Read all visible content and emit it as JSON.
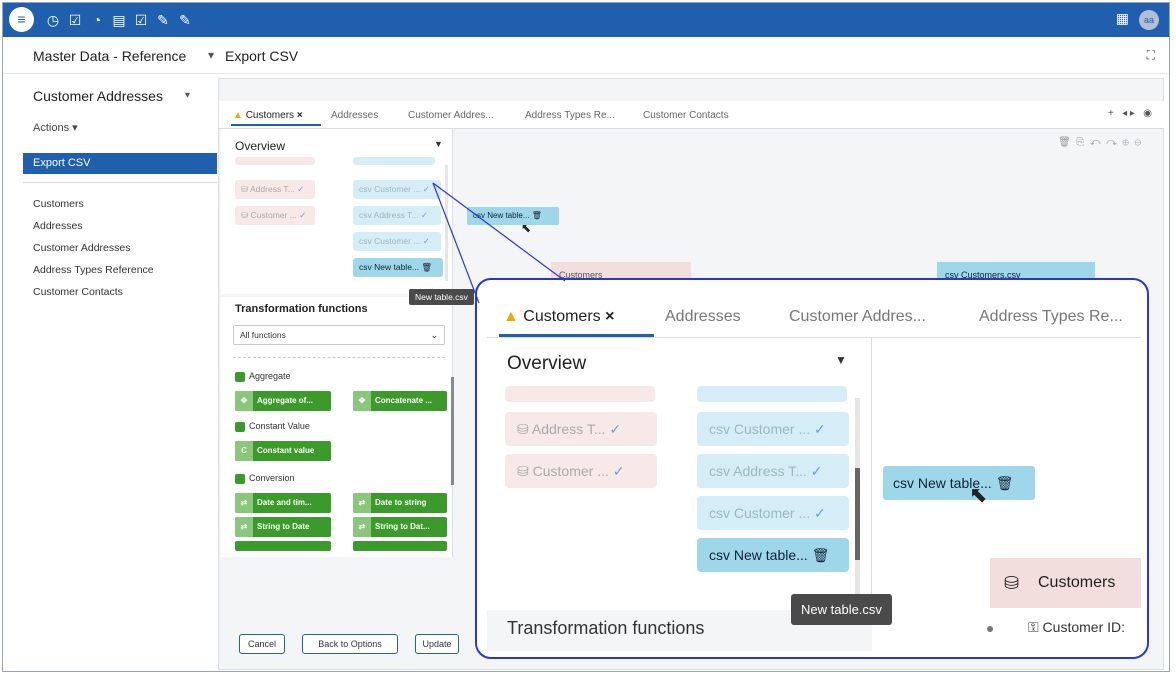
{
  "app": {
    "logo_label": "≡",
    "toolbar_icons": [
      "clock-icon",
      "check-icon",
      "gauge-icon",
      "document-icon",
      "task-icon",
      "plug-icon",
      "wrench-icon"
    ],
    "avatar": "aa"
  },
  "header": {
    "project": "Master Data - Reference",
    "page": "Export CSV"
  },
  "sidebar": {
    "title": "Customer Addresses",
    "actions": "Actions ▾",
    "active": "Export CSV",
    "items": [
      "Customers",
      "Addresses",
      "Customer Addresses",
      "Address Types Reference",
      "Customer Contacts"
    ]
  },
  "tabs": {
    "active": "Customers",
    "items": [
      "Addresses",
      "Customer Addres...",
      "Address Types Re...",
      "Customer Contacts"
    ]
  },
  "overview": {
    "title": "Overview",
    "db_items": [
      "Address T...",
      "Customer ..."
    ],
    "csv_items": [
      "Customer ...",
      "Address T...",
      "Customer ..."
    ],
    "new_table": "New table...",
    "tooltip": "New table.csv"
  },
  "transform": {
    "title": "Transformation functions",
    "filter": "All functions",
    "cat_aggregate": "Aggregate",
    "aggregate_fns": [
      "Aggregate of...",
      "Concatenate ..."
    ],
    "cat_constant": "Constant Value",
    "constant_fn": "Constant value",
    "cat_conversion": "Conversion",
    "conversion_fns": [
      "Date and tim...",
      "Date to string",
      "String to Date",
      "String to Dat..."
    ]
  },
  "canvas": {
    "new_table": "New table...",
    "bg_customers": "Customers",
    "bg_customers_csv": "Customers.csv"
  },
  "buttons": {
    "cancel": "Cancel",
    "back": "Back to Options",
    "update": "Update"
  },
  "zoom": {
    "tab_active": "Customers",
    "tabs": [
      "Addresses",
      "Customer Addres...",
      "Address Types Re..."
    ],
    "ov_title": "Overview",
    "db_items": [
      "Address T...",
      "Customer ..."
    ],
    "csv_items": [
      "Customer ...",
      "Address T...",
      "Customer ..."
    ],
    "new_table": "New table...",
    "tooltip": "New table.csv",
    "tf_title": "Transformation functions",
    "canvas_new": "New table...",
    "customers_node": "Customers",
    "customer_id": "Customer ID:"
  },
  "colors": {
    "primary": "#1f5fae",
    "csv": "#9fd7ea",
    "db": "#f3dede",
    "fn": "#3a9a2a",
    "zoom_border": "#2a35d8"
  }
}
